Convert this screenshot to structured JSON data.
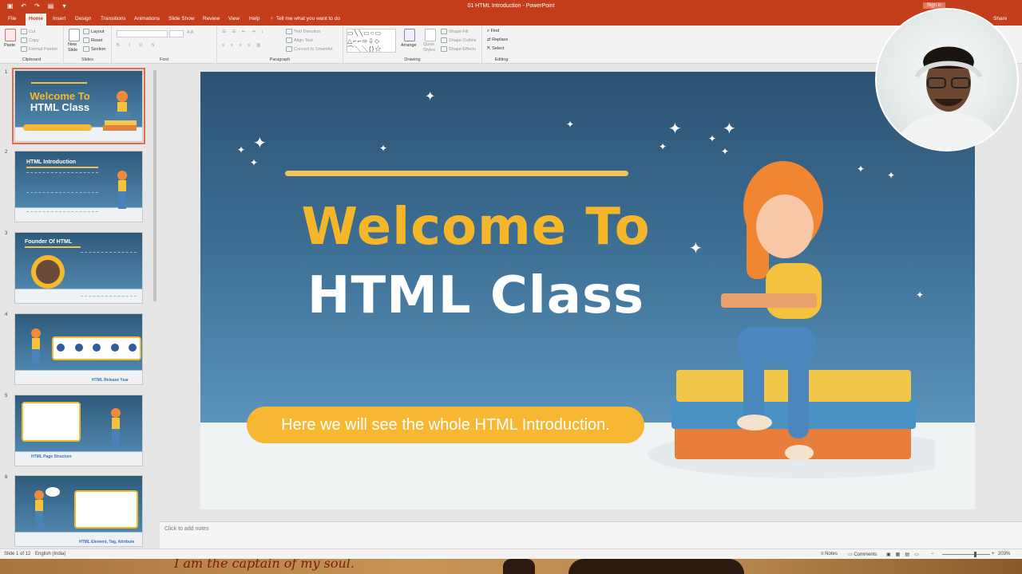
{
  "window": {
    "title": "01 HTML Introduction - PowerPoint",
    "sign_in": "Sign in",
    "share": "Share"
  },
  "tabs": [
    "File",
    "Home",
    "Insert",
    "Design",
    "Transitions",
    "Animations",
    "Slide Show",
    "Review",
    "View",
    "Help"
  ],
  "tell_me": "Tell me what you want to do",
  "ribbon": {
    "clipboard": {
      "label": "Clipboard",
      "paste": "Paste",
      "cut": "Cut",
      "copy": "Copy",
      "format_painter": "Format Painter"
    },
    "slides": {
      "label": "Slides",
      "new_slide_line1": "New",
      "new_slide_line2": "Slide",
      "layout": "Layout",
      "reset": "Reset",
      "section": "Section"
    },
    "font": {
      "label": "Font"
    },
    "paragraph": {
      "label": "Paragraph",
      "text_direction": "Text Direction",
      "align_text": "Align Text",
      "convert_smartart": "Convert to SmartArt"
    },
    "drawing": {
      "label": "Drawing",
      "arrange": "Arrange",
      "quick_styles_line1": "Quick",
      "quick_styles_line2": "Styles",
      "shape_fill": "Shape Fill",
      "shape_outline": "Shape Outline",
      "shape_effects": "Shape Effects"
    },
    "editing": {
      "label": "Editing",
      "find": "Find",
      "replace": "Replace",
      "select": "Select"
    }
  },
  "thumbnails": [
    {
      "num": "1",
      "title1": "Welcome To",
      "title2": "HTML Class"
    },
    {
      "num": "2",
      "title": "HTML Introduction"
    },
    {
      "num": "3",
      "title": "Founder Of HTML"
    },
    {
      "num": "4",
      "caption": "HTML Release Year"
    },
    {
      "num": "5",
      "caption": "HTML Page Structure"
    },
    {
      "num": "6",
      "caption": "HTML Element, Tag, Attribute"
    }
  ],
  "slide": {
    "line1": "Welcome To",
    "line2": "HTML Class",
    "subtitle": "Here we will see the whole HTML Introduction."
  },
  "notes_placeholder": "Click to add notes",
  "status": {
    "slide_of": "Slide 1 of 12",
    "language": "English (India)",
    "notes": "Notes",
    "comments": "Comments",
    "zoom": "203%"
  },
  "overlay_text": "I am the captain of my soul."
}
